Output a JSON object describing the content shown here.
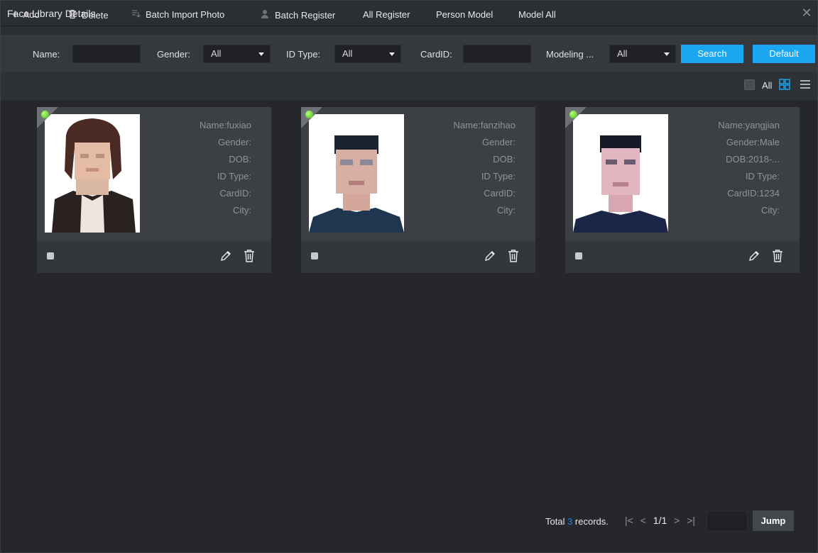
{
  "window": {
    "title": "Face Library Details"
  },
  "filters": {
    "name_label": "Name:",
    "gender_label": "Gender:",
    "gender_value": "All",
    "idtype_label": "ID Type:",
    "idtype_value": "All",
    "cardid_label": "CardID:",
    "modeling_label": "Modeling ...",
    "modeling_value": "All",
    "search_label": "Search",
    "default_label": "Default"
  },
  "toolbar": {
    "add": "Add",
    "delete": "Delete",
    "batch_import": "Batch Import Photo",
    "batch_register": "Batch Register",
    "all_register": "All Register",
    "person_model": "Person Model",
    "model_all": "Model All",
    "all": "All"
  },
  "cards": [
    {
      "name": "Name:fuxiao",
      "gender": "Gender:",
      "dob": "DOB:",
      "idtype": "ID Type:",
      "cardid": "CardID:",
      "city": "City:"
    },
    {
      "name": "Name:fanzihao",
      "gender": "Gender:",
      "dob": "DOB:",
      "idtype": "ID Type:",
      "cardid": "CardID:",
      "city": "City:"
    },
    {
      "name": "Name:yangjian",
      "gender": "Gender:Male",
      "dob": "DOB:2018-...",
      "idtype": "ID Type:",
      "cardid": "CardID:1234",
      "city": "City:"
    }
  ],
  "pager": {
    "total_prefix": "Total ",
    "total_count": "3",
    "total_suffix": " records.",
    "page": "1/1",
    "jump": "Jump"
  },
  "colors": {
    "accent": "#1aa6f0",
    "online_dot": "#47b51a",
    "background": "#25272b"
  }
}
